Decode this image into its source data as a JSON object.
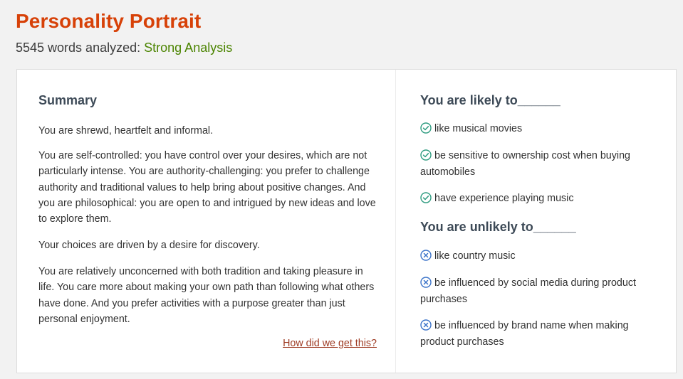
{
  "header": {
    "title": "Personality Portrait",
    "word_count_text": "5545 words analyzed:",
    "strength_text": "Strong Analysis"
  },
  "summary": {
    "heading": "Summary",
    "paragraphs": [
      "You are shrewd, heartfelt and informal.",
      "You are self-controlled: you have control over your desires, which are not particularly intense. You are authority-challenging: you prefer to challenge authority and traditional values to help bring about positive changes. And you are philosophical: you are open to and intrigued by new ideas and love to explore them.",
      "Your choices are driven by a desire for discovery.",
      "You are relatively unconcerned with both tradition and taking pleasure in life. You care more about making your own path than following what others have done. And you prefer activities with a purpose greater than just personal enjoyment."
    ],
    "how_link": "How did we get this?"
  },
  "likely": {
    "heading": "You are likely to______",
    "icon": "check-circle-icon",
    "items": [
      "like musical movies",
      "be sensitive to ownership cost when buying automobiles",
      "have experience playing music"
    ]
  },
  "unlikely": {
    "heading": "You are unlikely to______",
    "icon": "x-circle-icon",
    "items": [
      "like country music",
      "be influenced by social media during product purchases",
      "be influenced by brand name when making product purchases"
    ]
  },
  "colors": {
    "title": "#d74108",
    "strength": "#4b8400",
    "check": "#2f9c80",
    "x_icon": "#3b73c9",
    "link": "#9e3a22"
  }
}
